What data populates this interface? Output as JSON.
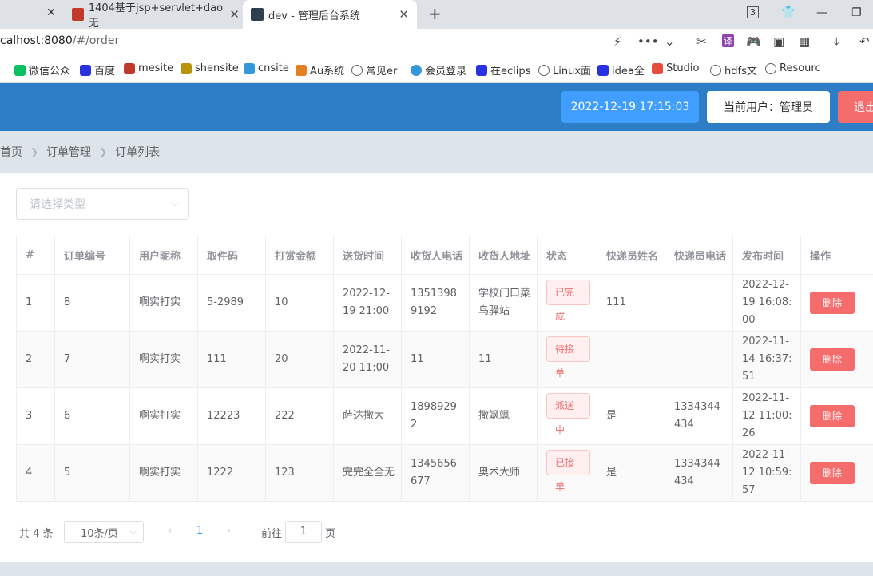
{
  "browser": {
    "tabs": [
      {
        "label": "1404基于jsp+servlet+dao无"
      },
      {
        "label": "dev - 管理后台系统"
      }
    ],
    "address": {
      "host": "calhost:8080",
      "path": "/#/order"
    },
    "bookmarks": [
      {
        "label": "微信公众"
      },
      {
        "label": "百度"
      },
      {
        "label": "mesite"
      },
      {
        "label": "shensite"
      },
      {
        "label": "cnsite"
      },
      {
        "label": "Au系统"
      },
      {
        "label": "常见er"
      },
      {
        "label": "会员登录"
      },
      {
        "label": "在eclips"
      },
      {
        "label": "Linux面"
      },
      {
        "label": "idea全"
      },
      {
        "label": "Studio"
      },
      {
        "label": "hdfs文"
      },
      {
        "label": "Resourc"
      }
    ]
  },
  "header": {
    "datetime": "2022-12-19 17:15:03",
    "current_user": "当前用户：管理员",
    "logout": "退出"
  },
  "breadcrumb": [
    "首页",
    "订单管理",
    "订单列表"
  ],
  "filter": {
    "placeholder": "请选择类型"
  },
  "table": {
    "columns": [
      "#",
      "订单编号",
      "用户昵称",
      "取件码",
      "打赏金额",
      "送货时间",
      "收货人电话",
      "收货人地址",
      "状态",
      "快递员姓名",
      "快递员电话",
      "发布时间",
      "操作"
    ],
    "rows": [
      {
        "idx": "1",
        "order_no": "8",
        "nickname": "啊实打实",
        "code": "5-2989",
        "reward": "10",
        "delivery_time": "2022-12-19 21:00",
        "phone": "13513989192",
        "address": "学校门口菜鸟驿站",
        "status": "已完成",
        "courier": "111",
        "courier_phone": "",
        "publish_time": "2022-12-19 16:08:00",
        "action": "删除"
      },
      {
        "idx": "2",
        "order_no": "7",
        "nickname": "啊实打实",
        "code": "111",
        "reward": "20",
        "delivery_time": "2022-11-20 11:00",
        "phone": "11",
        "address": "11",
        "status": "待接单",
        "courier": "",
        "courier_phone": "",
        "publish_time": "2022-11-14 16:37:51",
        "action": "删除"
      },
      {
        "idx": "3",
        "order_no": "6",
        "nickname": "啊实打实",
        "code": "12223",
        "reward": "222",
        "delivery_time": "萨达撒大",
        "phone": "18989292",
        "address": "撒飒飒",
        "status": "派送中",
        "courier": "是",
        "courier_phone": "1334344434",
        "publish_time": "2022-11-12 11:00:26",
        "action": "删除"
      },
      {
        "idx": "4",
        "order_no": "5",
        "nickname": "啊实打实",
        "code": "1222",
        "reward": "123",
        "delivery_time": "完完全全无",
        "phone": "1345656677",
        "address": "奥术大师",
        "status": "已接单",
        "courier": "是",
        "courier_phone": "1334344434",
        "publish_time": "2022-11-12 10:59:57",
        "action": "删除"
      }
    ]
  },
  "pagination": {
    "total": "共 4 条",
    "page_size": "10条/页",
    "current": "1",
    "goto_prefix": "前往",
    "goto_value": "1",
    "goto_suffix": "页"
  },
  "colors": {
    "header_bg": "#2e7ec6",
    "primary": "#409eff",
    "danger": "#f56c6c"
  }
}
